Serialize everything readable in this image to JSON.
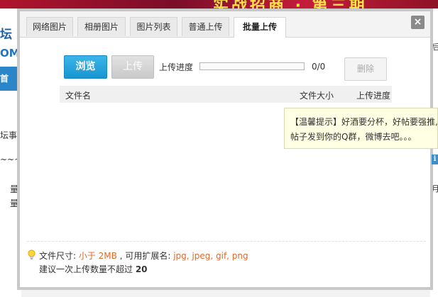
{
  "background": {
    "banner_text": "实战招商 · 第三期",
    "logo_line1": "坛",
    "logo_line2": "OM",
    "nav_text": "首",
    "text_1": "坛事务",
    "text_2": "~~~~",
    "text_3": "量",
    "text_4": "量",
    "right_text_1": "后",
    "right_text_2": "月"
  },
  "dialog": {
    "tabs": [
      {
        "label": "网络图片",
        "active": false
      },
      {
        "label": "相册图片",
        "active": false
      },
      {
        "label": "图片列表",
        "active": false
      },
      {
        "label": "普通上传",
        "active": false
      },
      {
        "label": "批量上传",
        "active": true
      }
    ],
    "close_symbol": "×",
    "browse_label": "浏览",
    "upload_label": "上传",
    "progress_label": "上传进度",
    "progress_fraction": 0,
    "progress_count": "0/0",
    "delete_label": "删除",
    "table_columns": [
      "文件名",
      "文件大小",
      "上传进度"
    ],
    "footer": {
      "size_prefix": "文件尺寸: ",
      "size_value": "小于 2MB",
      "ext_prefix": " , 可用扩展名: ",
      "ext_value": "jpg, jpeg, gif, png",
      "limit_prefix": "建议一次上传数量不超过 ",
      "limit_value": "20"
    }
  },
  "tooltip": {
    "line1": "【温馨提示】好酒要分杯，好帖要强推,",
    "line2": "帖子发到你的Q群，微博去吧。。。"
  },
  "info_icon": "i",
  "colors": {
    "browse_button": "#1795cf",
    "highlight_text": "#e06a2c",
    "tooltip_bg": "#ffffe4"
  }
}
